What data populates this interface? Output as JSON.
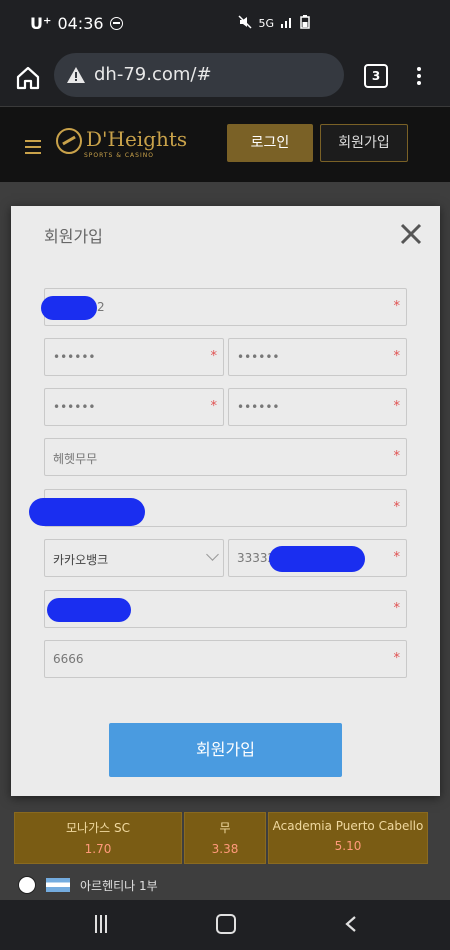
{
  "status_bar": {
    "carrier": "U⁺",
    "time": "04:36",
    "network": "5G"
  },
  "browser": {
    "url": "dh-79.com/#",
    "tab_count": "3"
  },
  "site_header": {
    "logo_text": "D'Heights",
    "logo_sub": "SPORTS & CASINO",
    "login_label": "로그인",
    "signup_label": "회원가입"
  },
  "modal": {
    "title": "회원가입",
    "fields": {
      "userid": "2",
      "password": "••••••",
      "password_confirm": "••••••",
      "pin": "••••••",
      "pin_confirm": "••••••",
      "nickname": "헤헷무무",
      "name": "",
      "bank": "카카오뱅크",
      "account_number": "33332",
      "phone": "",
      "code": "6666"
    },
    "required_mark": "*",
    "submit_label": "회원가입"
  },
  "background_page": {
    "odds": [
      {
        "name": "모나가스 SC",
        "odd": "1.70"
      },
      {
        "name": "무",
        "odd": "3.38"
      },
      {
        "name": "Academia Puerto Cabello",
        "odd": "5.10"
      }
    ],
    "league": "아르헨티나 1부"
  }
}
